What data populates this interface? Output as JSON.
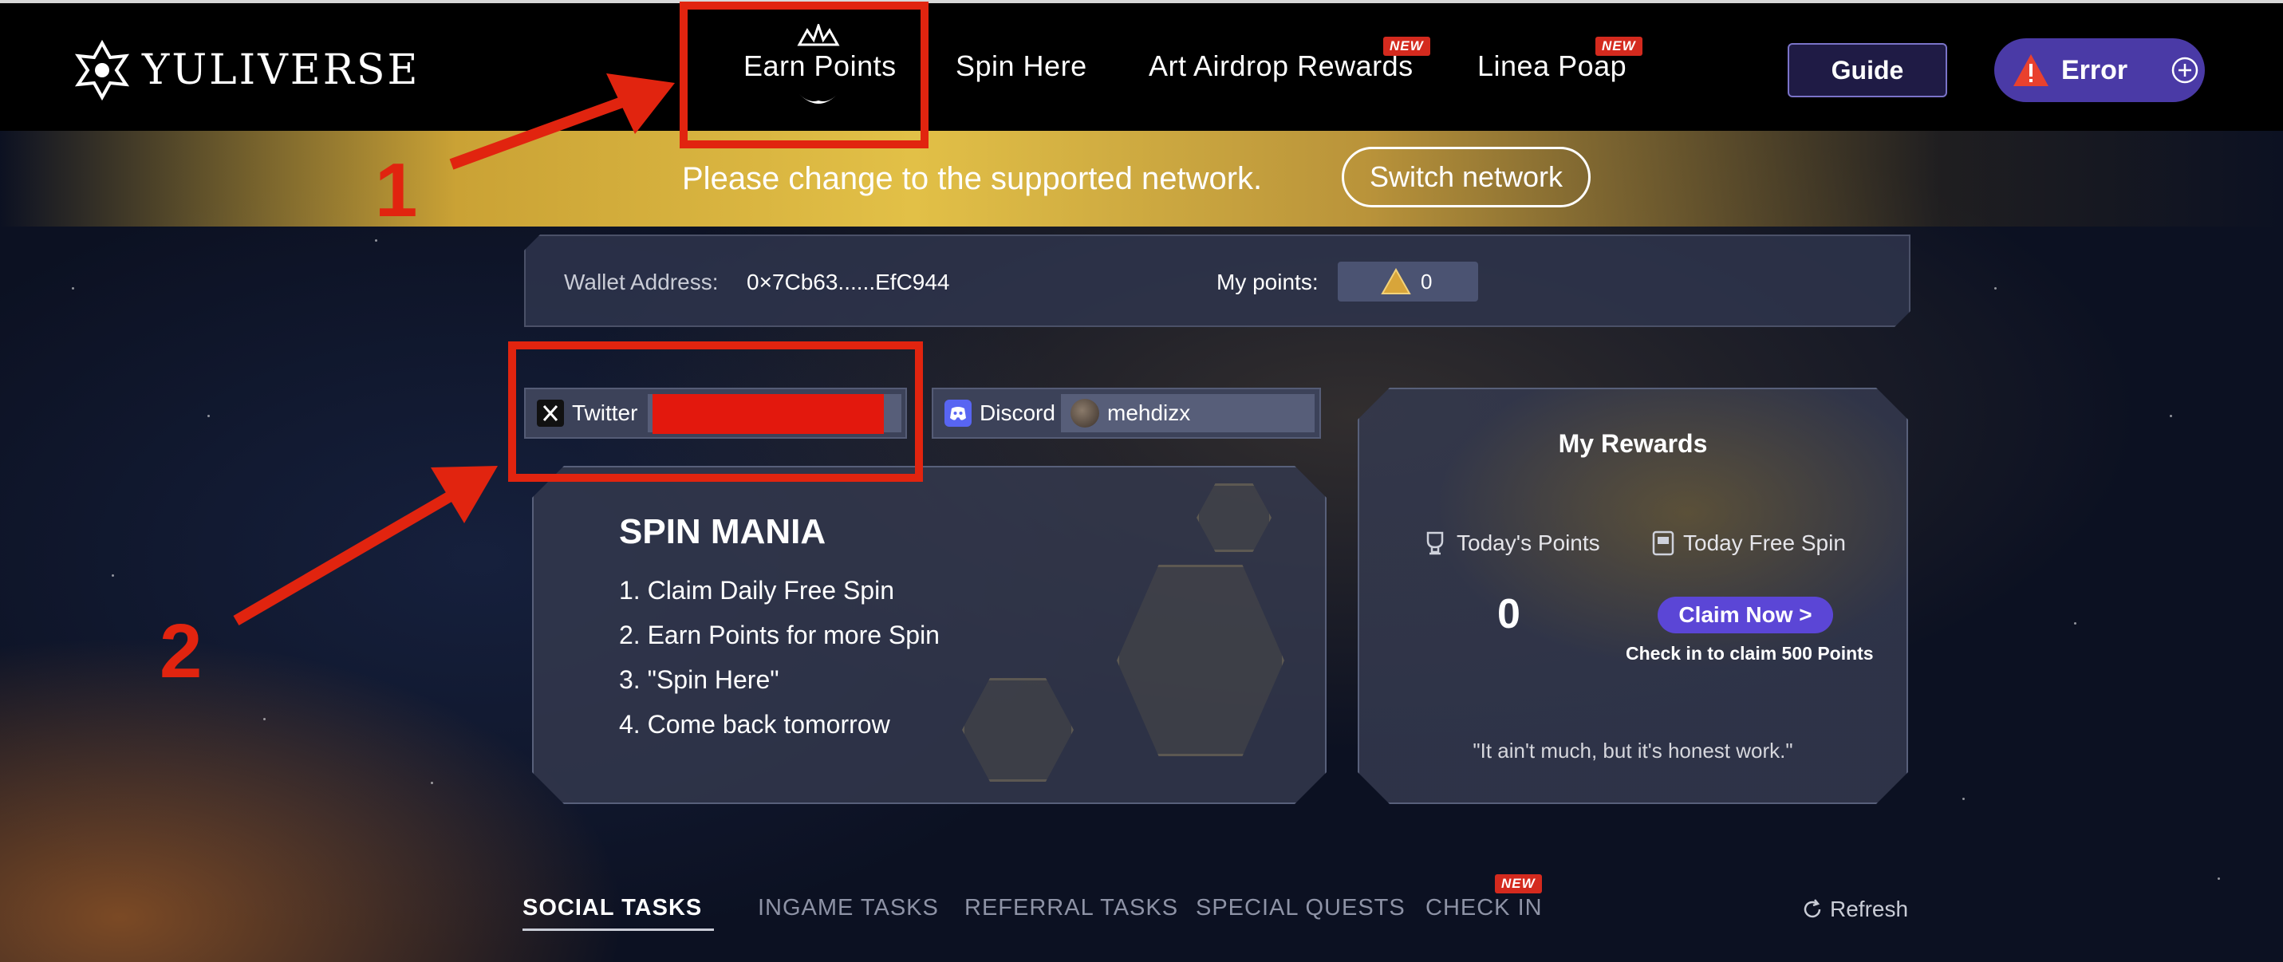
{
  "brand": {
    "name": "YULIVERSE"
  },
  "nav": {
    "items": [
      {
        "label": "Earn Points",
        "new": false
      },
      {
        "label": "Spin Here",
        "new": false
      },
      {
        "label": "Art Airdrop Rewards",
        "new": true
      },
      {
        "label": "Linea Poap",
        "new": true
      }
    ],
    "new_badge": "NEW",
    "guide_label": "Guide",
    "error_label": "Error"
  },
  "network": {
    "message": "Please change to the supported network.",
    "switch_label": "Switch network"
  },
  "wallet": {
    "address_label": "Wallet Address:",
    "address_value": "0×7Cb63......EfC944",
    "points_label": "My points:",
    "points_value": "0"
  },
  "social": {
    "twitter_label": "Twitter",
    "discord_label": "Discord",
    "discord_user": "mehdizx"
  },
  "spin": {
    "title": "SPIN MANIA",
    "steps": [
      "1. Claim Daily Free Spin",
      "2. Earn Points for more Spin",
      "3. \"Spin Here\"",
      "4. Come back tomorrow"
    ]
  },
  "rewards": {
    "title": "My Rewards",
    "todays_points_label": "Today's Points",
    "today_free_spin_label": "Today Free Spin",
    "points_value": "0",
    "claim_label": "Claim Now >",
    "claim_note": "Check in to claim 500 Points",
    "quote": "\"It ain't much, but it's honest work.\""
  },
  "tabs": {
    "items": [
      "SOCIAL TASKS",
      "INGAME TASKS",
      "REFERRAL TASKS",
      "SPECIAL QUESTS",
      "CHECK IN"
    ],
    "active": "SOCIAL TASKS",
    "refresh_label": "Refresh"
  },
  "annotations": {
    "one": "1",
    "two": "2"
  },
  "colors": {
    "accent": "#5b46d6",
    "annotation_red": "#e1240f",
    "banner_gold": "#e2c047",
    "nav_bg": "#000000"
  }
}
